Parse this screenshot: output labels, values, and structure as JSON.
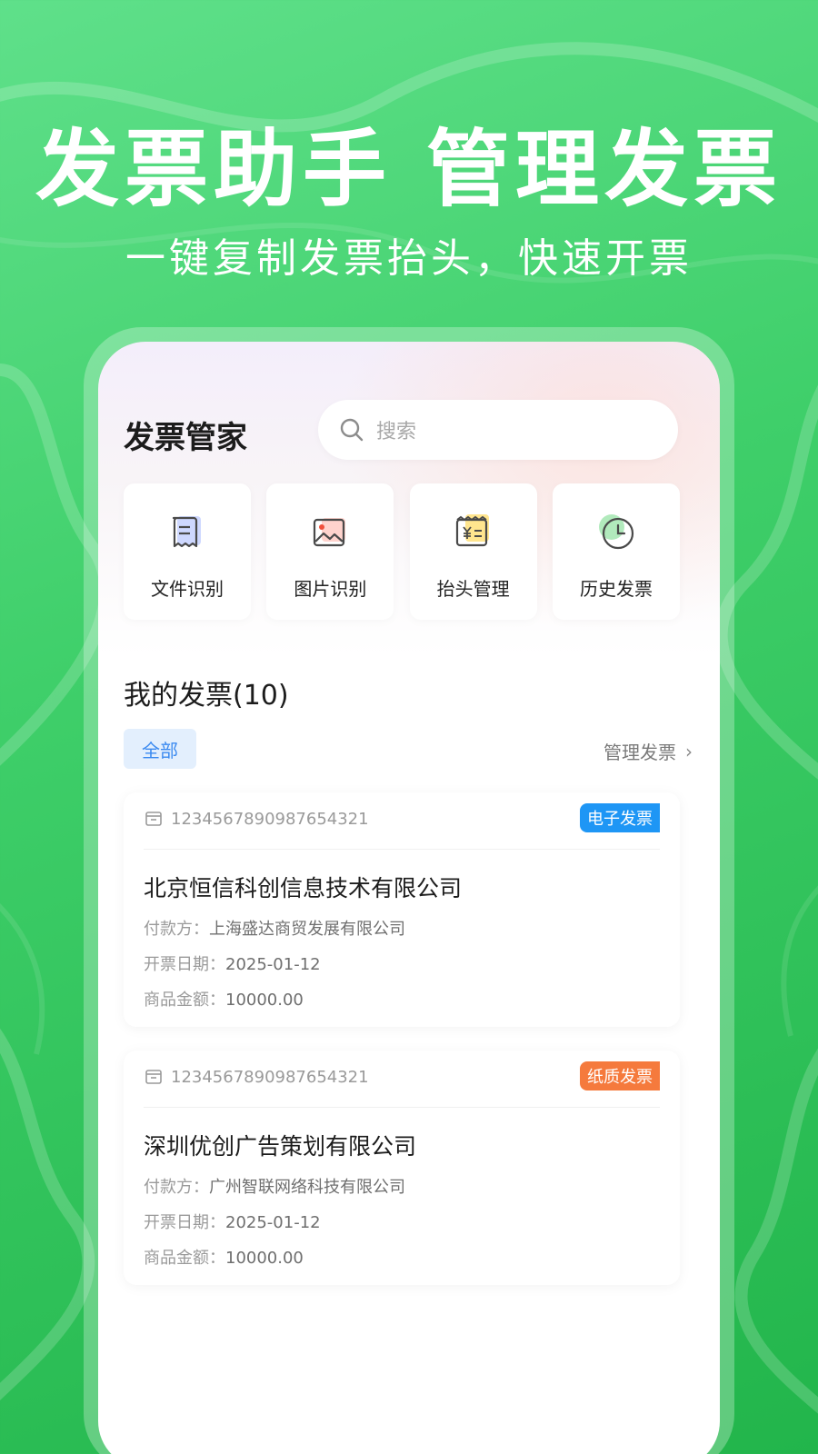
{
  "hero": {
    "title": "发票助手 管理发票",
    "subtitle": "一键复制发票抬头，快速开票"
  },
  "app": {
    "title": "发票管家",
    "search_placeholder": "搜索"
  },
  "tools": [
    {
      "label": "文件识别",
      "icon": "file-scan-icon"
    },
    {
      "label": "图片识别",
      "icon": "image-scan-icon"
    },
    {
      "label": "抬头管理",
      "icon": "receipt-yen-icon"
    },
    {
      "label": "历史发票",
      "icon": "clock-icon"
    }
  ],
  "section": {
    "title": "我的发票(10)",
    "filter_all": "全部",
    "manage": "管理发票",
    "manage_chevron": "›"
  },
  "invoices": [
    {
      "number": "1234567890987654321",
      "badge": "电子发票",
      "badge_color": "#1e96f5",
      "company": "北京恒信科创信息技术有限公司",
      "payer_label": "付款方：",
      "payer": "上海盛达商贸发展有限公司",
      "date_label": "开票日期：",
      "date": "2025-01-12",
      "amount_label": "商品金额：",
      "amount": "10000.00"
    },
    {
      "number": "1234567890987654321",
      "badge": "纸质发票",
      "badge_color": "#f57a3d",
      "company": "深圳优创广告策划有限公司",
      "payer_label": "付款方：",
      "payer": "广州智联网络科技有限公司",
      "date_label": "开票日期：",
      "date": "2025-01-12",
      "amount_label": "商品金额：",
      "amount": "10000.00"
    }
  ],
  "colors": {
    "background_green": "#3fcf6a",
    "accent_blue": "#3b8af0"
  }
}
